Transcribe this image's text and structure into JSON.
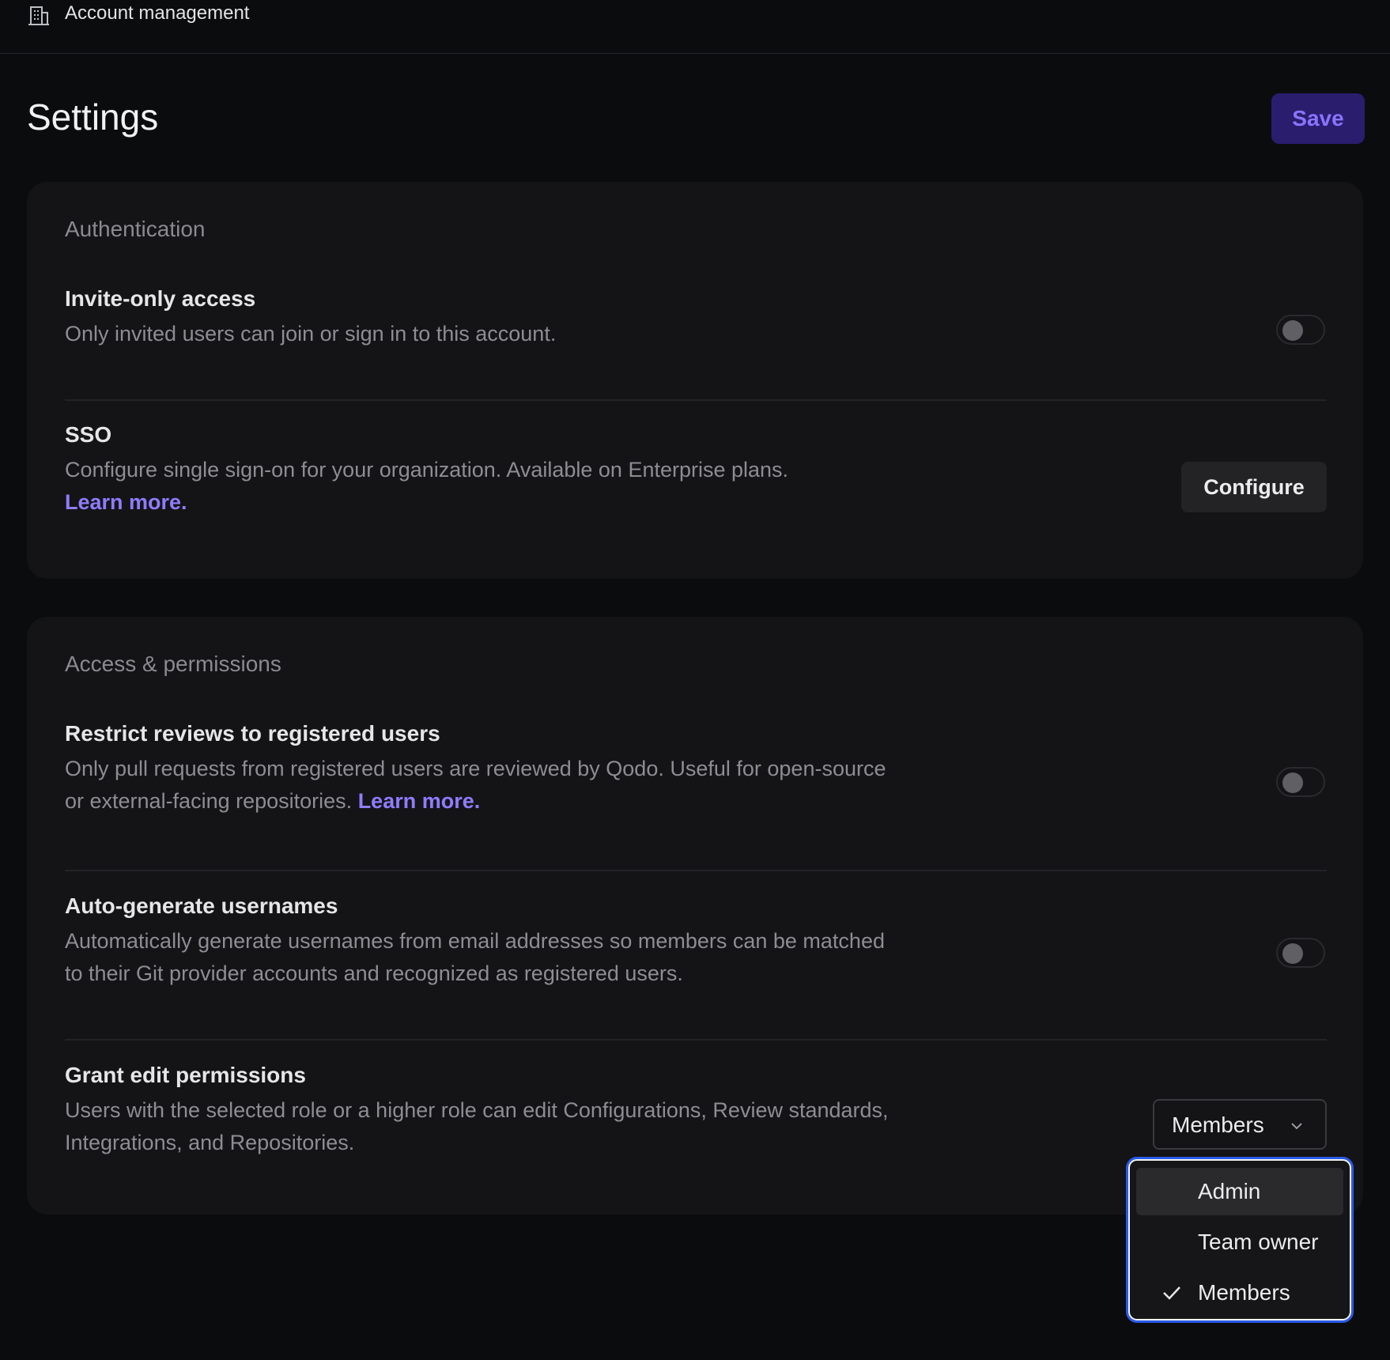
{
  "topbar": {
    "title": "Account management",
    "icon": "building-icon"
  },
  "page": {
    "title": "Settings",
    "save_label": "Save"
  },
  "colors": {
    "accent": "#8f7cff",
    "save_bg": "#2a1d6e",
    "focus_ring": "#2a5ae8"
  },
  "authentication": {
    "section_title": "Authentication",
    "invite_only": {
      "title": "Invite-only access",
      "description": "Only invited users can join or sign in to this account.",
      "enabled": false
    },
    "sso": {
      "title": "SSO",
      "description": "Configure single sign-on for your organization. Available on Enterprise plans.",
      "link": "Learn more.",
      "button_label": "Configure"
    }
  },
  "access": {
    "section_title": "Access & permissions",
    "restrict_reviews": {
      "title": "Restrict reviews to registered users",
      "description": "Only pull requests from registered users are reviewed by Qodo. Useful for open-source or external-facing repositories.",
      "link": "Learn more.",
      "enabled": false
    },
    "auto_usernames": {
      "title": "Auto-generate usernames",
      "description": "Automatically generate usernames from email addresses so members can be matched to their Git provider accounts and recognized as registered users.",
      "enabled": false
    },
    "grant_edit": {
      "title": "Grant edit permissions",
      "description": "Users with the selected role or a higher role can edit Configurations, Review standards, Integrations, and Repositories.",
      "selected": "Members",
      "options": [
        "Admin",
        "Team owner",
        "Members"
      ]
    }
  }
}
